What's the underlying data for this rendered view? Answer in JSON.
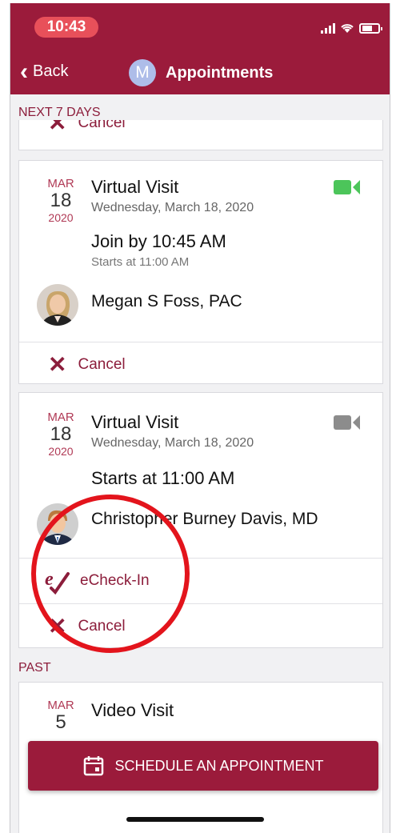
{
  "status_bar": {
    "time": "10:43"
  },
  "header": {
    "back_label": "Back",
    "avatar_letter": "M",
    "title": "Appointments"
  },
  "sections": {
    "upcoming": "NEXT 7 DAYS",
    "past": "PAST"
  },
  "top_card": {
    "cancel_label": "Cancel"
  },
  "appointments": [
    {
      "month": "MAR",
      "day": "18",
      "year": "2020",
      "type": "Virtual Visit",
      "date_long": "Wednesday, March 18, 2020",
      "main_line": "Join by 10:45 AM",
      "sub_line": "Starts at 11:00 AM",
      "provider": "Megan S Foss, PAC",
      "video_color": "#4cc55a",
      "cancel_label": "Cancel"
    },
    {
      "month": "MAR",
      "day": "18",
      "year": "2020",
      "type": "Virtual Visit",
      "date_long": "Wednesday, March 18, 2020",
      "main_line": "Starts at 11:00 AM",
      "provider": "Christopher Burney Davis, MD",
      "video_color": "#8c8c8c",
      "echeck_label": "eCheck-In",
      "cancel_label": "Cancel"
    }
  ],
  "past_appointment": {
    "month": "MAR",
    "day": "5",
    "type": "Video Visit"
  },
  "schedule_button": {
    "label": "SCHEDULE AN APPOINTMENT"
  },
  "colors": {
    "brand": "#9b1b3b",
    "highlight_circle": "#e3141c"
  }
}
